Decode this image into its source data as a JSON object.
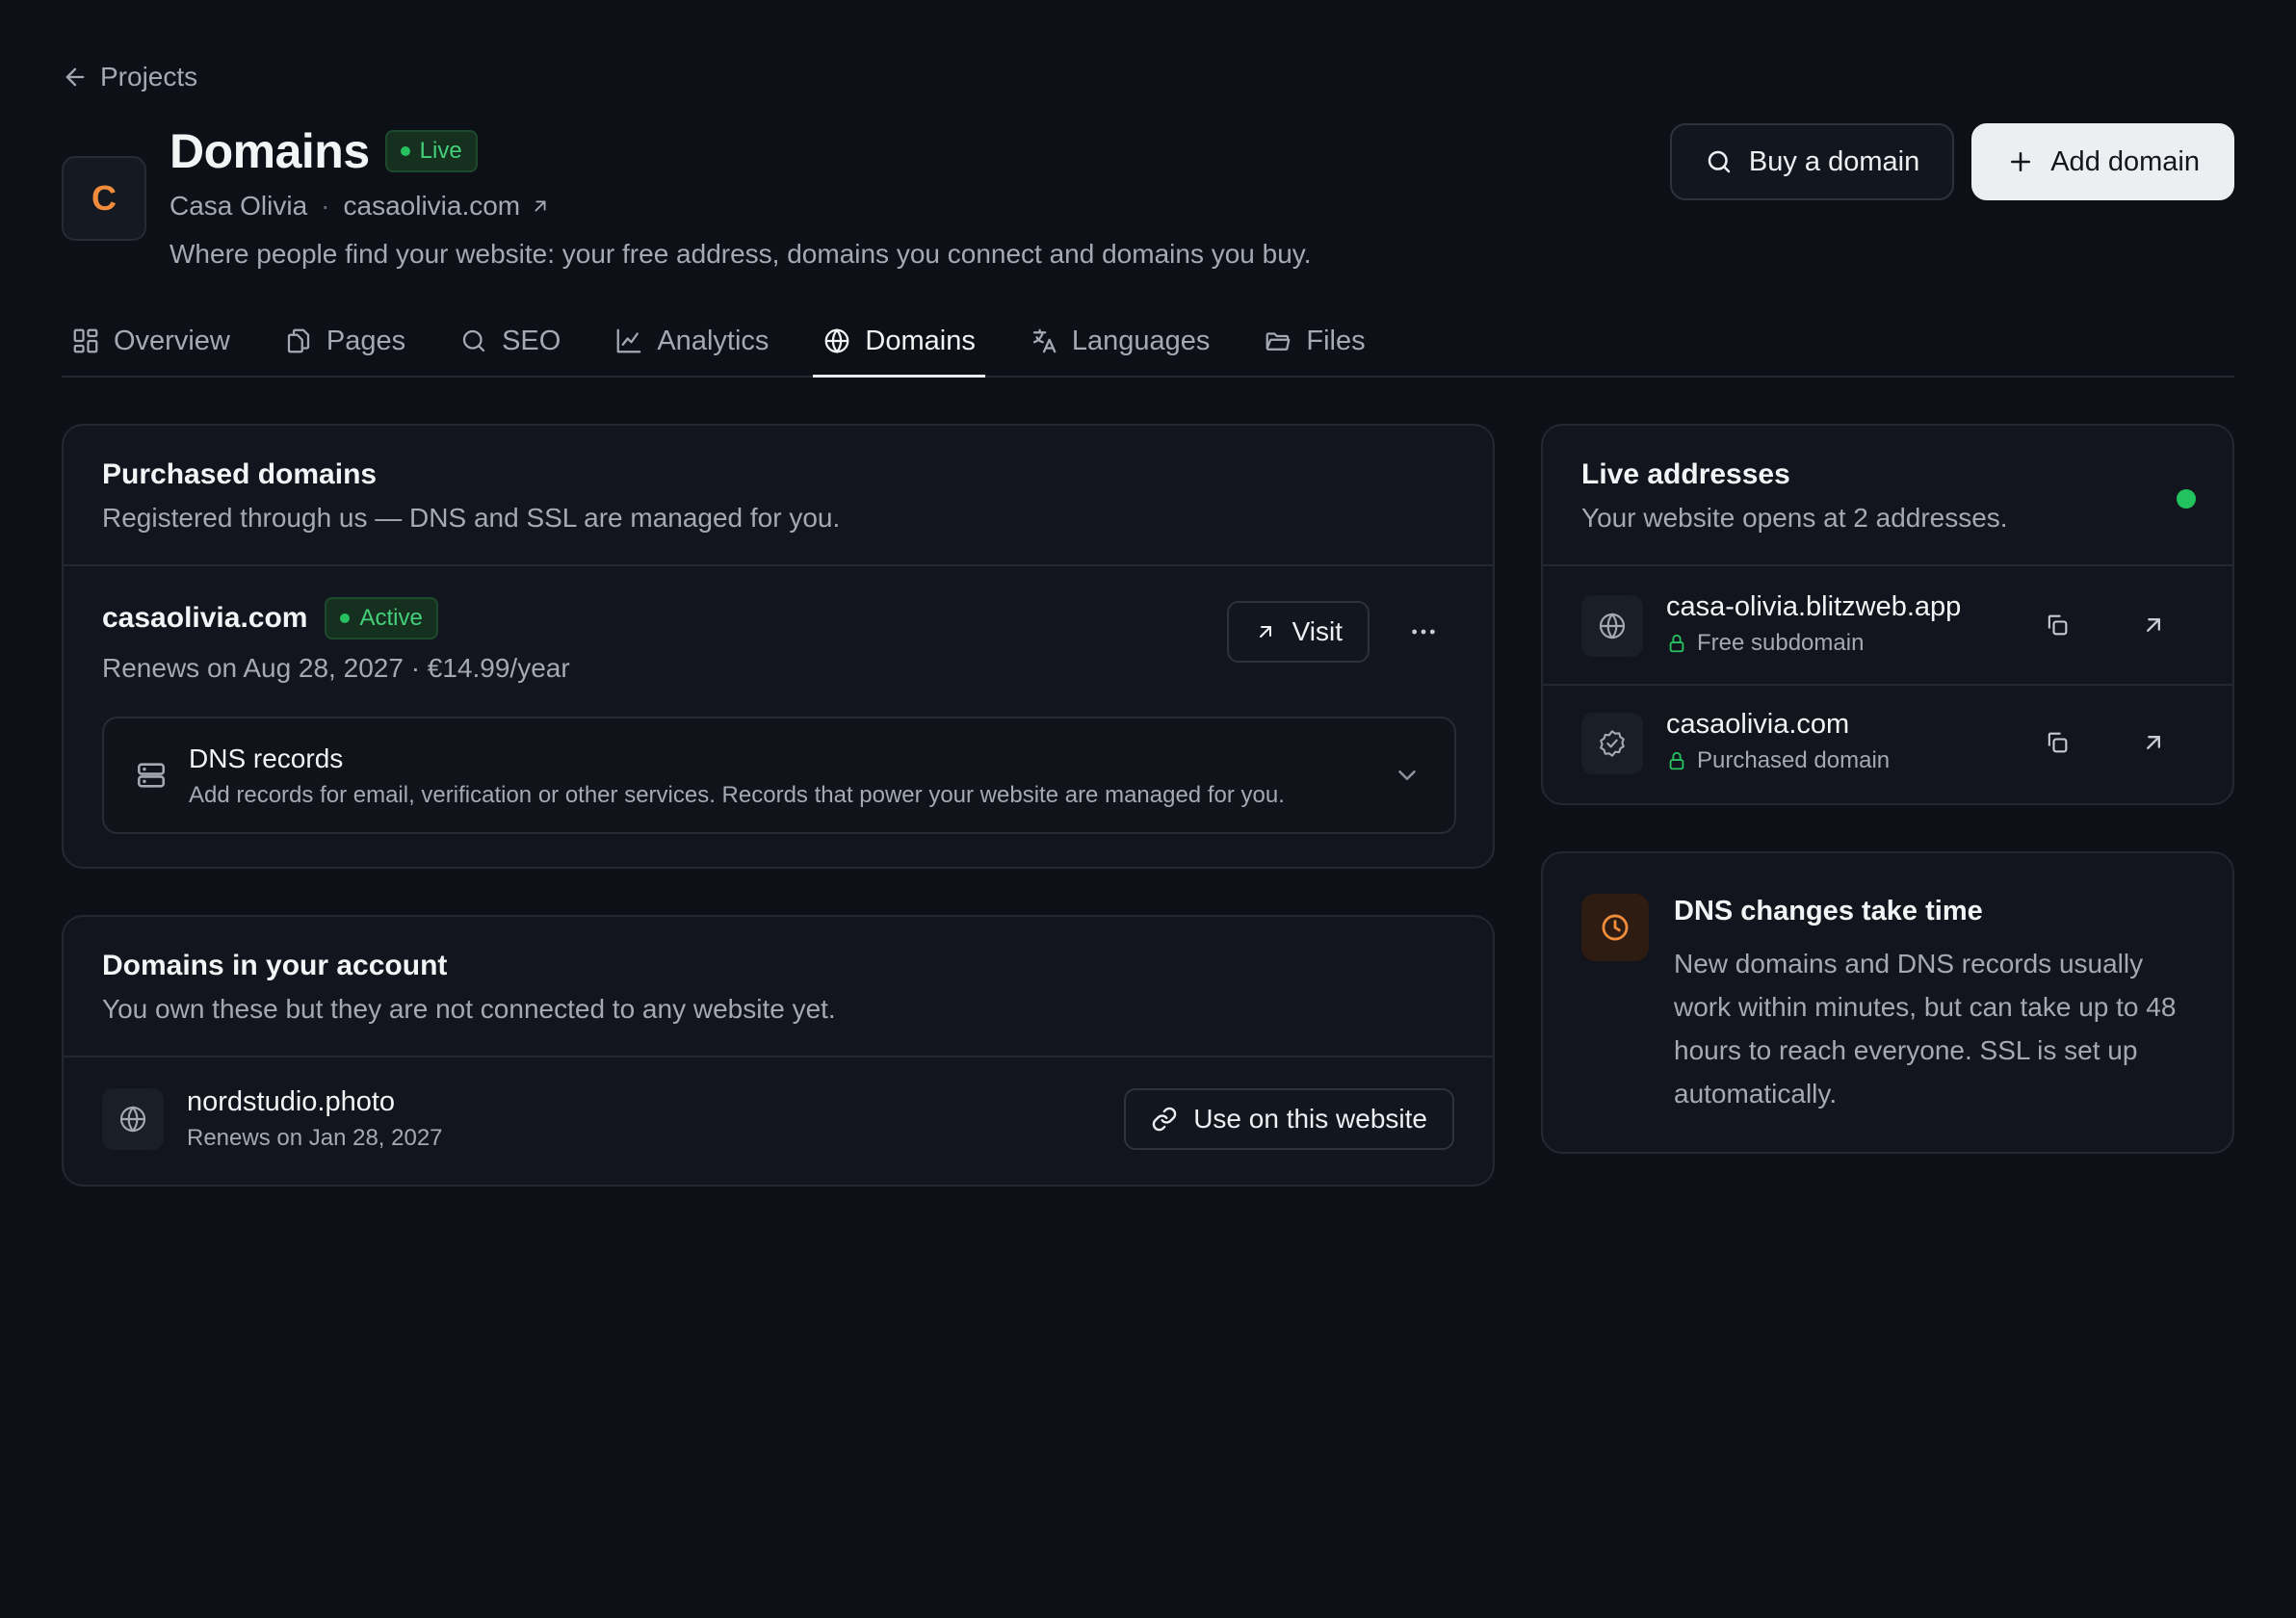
{
  "back": {
    "label": "Projects"
  },
  "site": {
    "avatar_letter": "C",
    "name": "Casa Olivia",
    "domain": "casaolivia.com",
    "separator": "·"
  },
  "header": {
    "title": "Domains",
    "status": "Live",
    "description": "Where people find your website: your free address, domains you connect and domains you buy.",
    "buy_label": "Buy a domain",
    "add_label": "Add domain"
  },
  "tabs": [
    {
      "label": "Overview",
      "icon": "overview-grid-icon"
    },
    {
      "label": "Pages",
      "icon": "pages-icon"
    },
    {
      "label": "SEO",
      "icon": "search-icon"
    },
    {
      "label": "Analytics",
      "icon": "chart-icon"
    },
    {
      "label": "Domains",
      "icon": "globe-icon",
      "active": true
    },
    {
      "label": "Languages",
      "icon": "translate-icon"
    },
    {
      "label": "Files",
      "icon": "folder-icon"
    }
  ],
  "purchased": {
    "title": "Purchased domains",
    "subtitle": "Registered through us — DNS and SSL are managed for you.",
    "domain": {
      "name": "casaolivia.com",
      "status": "Active",
      "renewal": "Renews on Aug 28, 2027 · €14.99/year",
      "visit_label": "Visit"
    },
    "dns": {
      "title": "DNS records",
      "subtitle": "Add records for email, verification or other services. Records that power your website are managed for you."
    }
  },
  "account": {
    "title": "Domains in your account",
    "subtitle": "You own these but they are not connected to any website yet.",
    "domain": {
      "name": "nordstudio.photo",
      "renewal": "Renews on Jan 28, 2027",
      "action_label": "Use on this website"
    }
  },
  "live": {
    "title": "Live addresses",
    "subtitle": "Your website opens at 2 addresses.",
    "addresses": [
      {
        "name": "casa-olivia.blitzweb.app",
        "type": "Free subdomain",
        "icon": "globe-icon"
      },
      {
        "name": "casaolivia.com",
        "type": "Purchased domain",
        "icon": "verified-check-icon"
      }
    ]
  },
  "notice": {
    "title": "DNS changes take time",
    "body": "New domains and DNS records usually work within minutes, but can take up to 48 hours to reach everyone. SSL is set up automatically."
  },
  "colors": {
    "background": "#0d1017",
    "card": "#12151d",
    "border": "#232833",
    "success": "#27c160",
    "accent_orange": "#f08c3c"
  }
}
